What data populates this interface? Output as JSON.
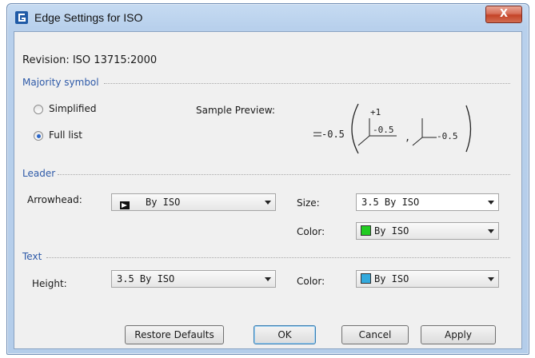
{
  "window": {
    "title": "Edge Settings for ISO",
    "close_glyph": "X"
  },
  "revision": "Revision: ISO 13715:2000",
  "majority": {
    "group_label": "Majority symbol",
    "options": [
      {
        "label": "Simplified",
        "checked": false
      },
      {
        "label": "Full list",
        "checked": true
      }
    ],
    "preview_label": "Sample Preview:",
    "preview": {
      "main_value": "-0.5",
      "plus_value": "+1",
      "inner_value": "-0.5",
      "separator": ",",
      "tail_value": "-0.5"
    }
  },
  "leader": {
    "group_label": "Leader",
    "arrowhead_label": "Arrowhead:",
    "arrowhead_value": "By ISO",
    "arrowhead_icon": "filled-arrow-icon",
    "size_label": "Size:",
    "size_value": "3.5 By ISO",
    "color_label": "Color:",
    "color_value": "By ISO",
    "color_swatch": "#22cc22"
  },
  "text": {
    "group_label": "Text",
    "height_label": "Height:",
    "height_value": "3.5 By ISO",
    "color_label": "Color:",
    "color_value": "By ISO",
    "color_swatch": "#33aadd"
  },
  "buttons": {
    "restore": "Restore Defaults",
    "ok": "OK",
    "cancel": "Cancel",
    "apply": "Apply"
  }
}
